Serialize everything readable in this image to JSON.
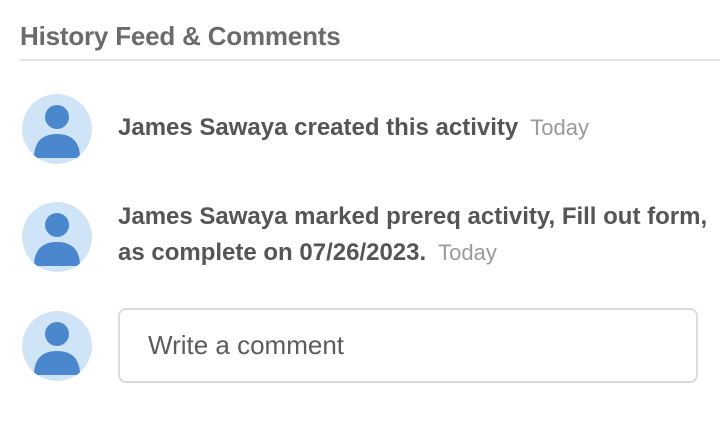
{
  "section": {
    "title": "History Feed & Comments"
  },
  "feed": [
    {
      "text": "James Sawaya created this activity",
      "time": "Today",
      "avatar_icon": "user-avatar-icon"
    },
    {
      "text": "James Sawaya marked prereq activity, Fill out form, as complete on 07/26/2023.",
      "time": "Today",
      "avatar_icon": "user-avatar-icon"
    }
  ],
  "comment": {
    "placeholder": "Write a comment",
    "value": "",
    "avatar_icon": "user-avatar-icon"
  },
  "colors": {
    "avatar_background": "#cfe4f7",
    "avatar_figure": "#4a87cc",
    "divider": "#e4e4e4",
    "input_border": "#dcdcdc"
  }
}
